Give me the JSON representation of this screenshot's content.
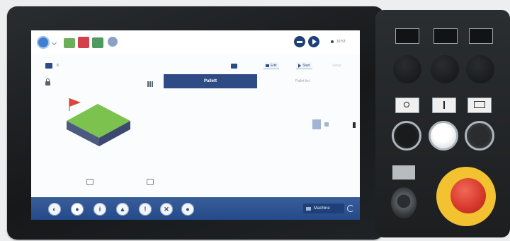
{
  "screen": {
    "toolbar": {
      "status_text": "16:53"
    },
    "secondary": {
      "page_indicator": "8",
      "btn1_label": "Edit",
      "btn2_label": "Start",
      "faded_label": "Setup"
    },
    "tab": {
      "label": "Pallett"
    },
    "side_label": "Pallet list",
    "bottombar": {
      "machine_label": "Machine"
    }
  },
  "colors": {
    "accent": "#2e4b86",
    "bottom_bar": "#2a4f8f",
    "pallet_top": "#7cc24e",
    "pallet_side": "#4d5a80",
    "flag": "#e0453a",
    "estop": "#d93a2c",
    "estop_ring": "#f2c230"
  },
  "icons": [
    "settings-icon",
    "folder-icon",
    "save-icon",
    "printer-icon",
    "globe-icon",
    "stop-icon",
    "play-icon",
    "lock-icon",
    "grid-icon",
    "home-icon",
    "cursor-icon",
    "info-icon",
    "image-icon",
    "alert-icon",
    "network-icon",
    "user-icon",
    "refresh-icon"
  ]
}
